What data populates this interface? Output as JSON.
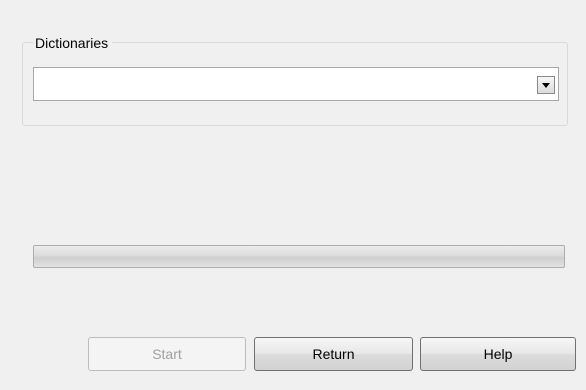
{
  "dictionaries_group": {
    "title": "Dictionaries",
    "combobox": {
      "selected_value": "",
      "dropdown_icon": "chevron-down-icon"
    }
  },
  "progress": {
    "value": 0
  },
  "buttons": {
    "start_label": "Start",
    "start_enabled": false,
    "return_label": "Return",
    "help_label": "Help"
  }
}
